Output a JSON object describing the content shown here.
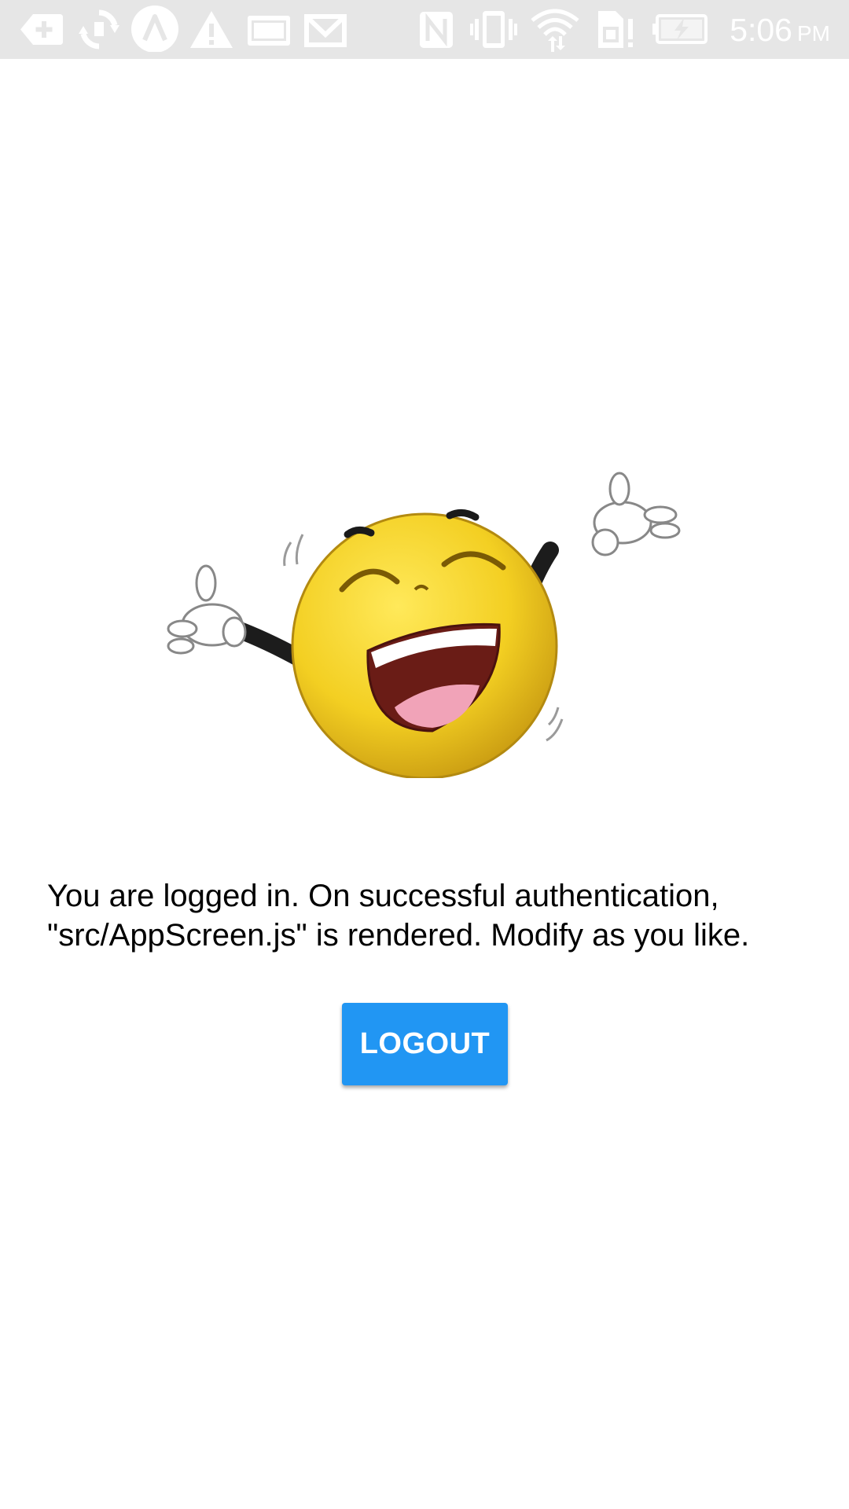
{
  "status_bar": {
    "time": "5:06",
    "ampm": "PM",
    "left_icons": [
      "add-notification-icon",
      "sync-icon",
      "arc-app-icon",
      "warning-icon",
      "storage-icon",
      "mail-icon"
    ],
    "right_icons": [
      "nfc-icon",
      "vibrate-icon",
      "wifi-icon",
      "sim-alert-icon",
      "battery-charging-icon"
    ],
    "background_color": "#e6e6e6",
    "icon_color": "#ffffff"
  },
  "main": {
    "image": "laughing-emoji-icon",
    "message": "You are logged in. On successful authentication, \"src/AppScreen.js\" is rendered. Modify as you like.",
    "logout_label": "LOGOUT",
    "button_color": "#2196f3"
  }
}
